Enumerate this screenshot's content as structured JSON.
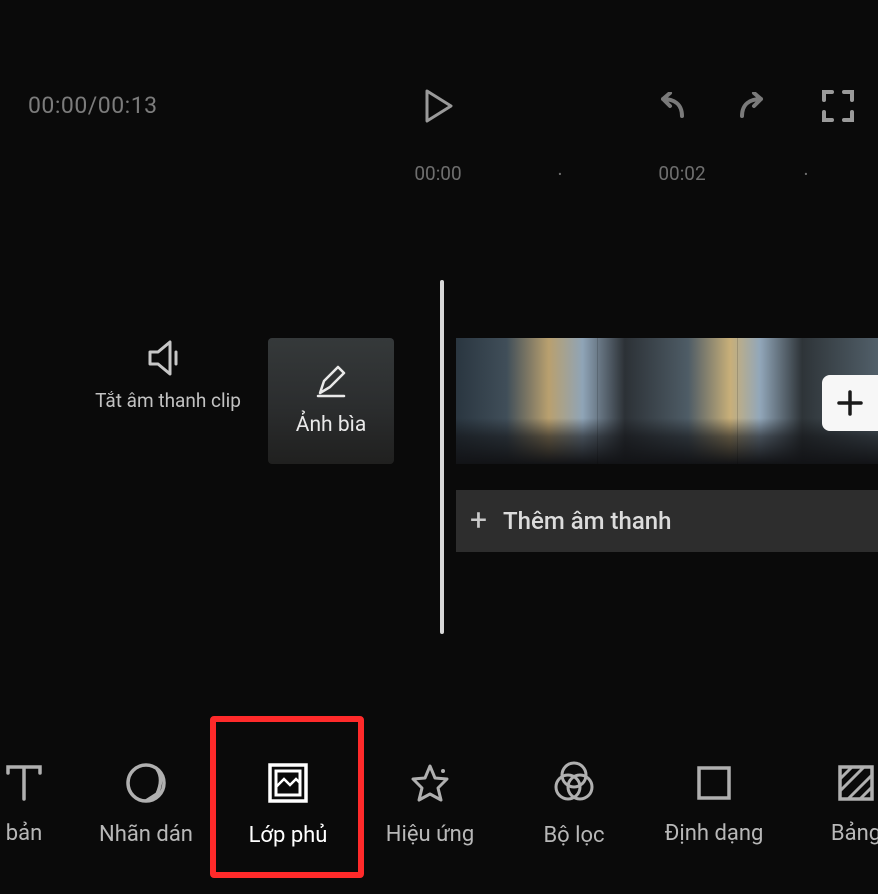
{
  "player": {
    "timecode": "00:00/00:13",
    "ruler": {
      "m1": "00:00",
      "m2": "00:02"
    }
  },
  "timeline": {
    "mute_label": "Tắt âm thanh clip",
    "cover_label": "Ảnh bìa",
    "add_audio_label": "Thêm âm thanh"
  },
  "toolbar": {
    "items": [
      {
        "label": "bản"
      },
      {
        "label": "Nhãn dán"
      },
      {
        "label": "Lớp phủ"
      },
      {
        "label": "Hiệu ứng"
      },
      {
        "label": "Bộ lọc"
      },
      {
        "label": "Định dạng"
      },
      {
        "label": "Bảng"
      }
    ],
    "active_index": 2
  }
}
